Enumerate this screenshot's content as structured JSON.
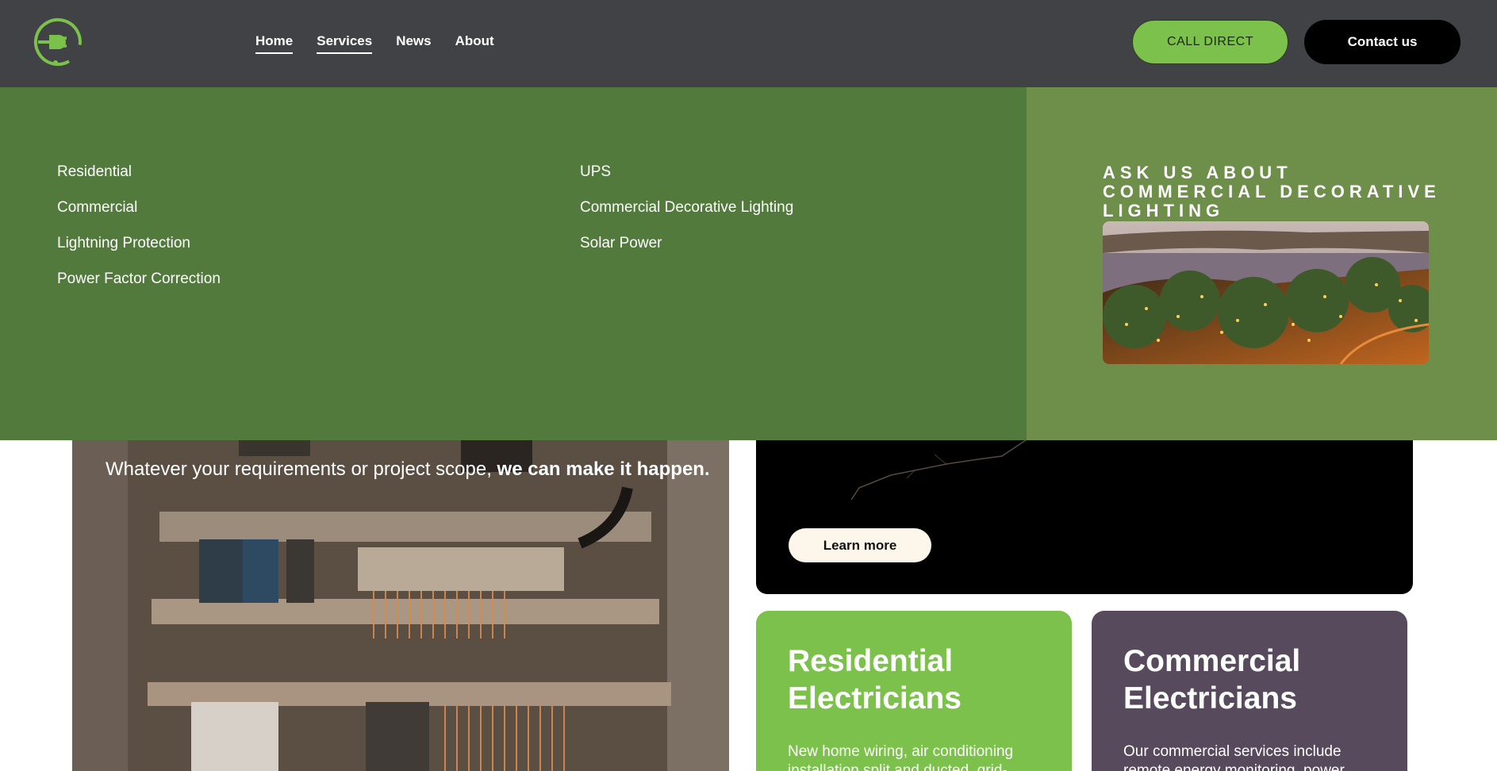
{
  "header": {
    "logo_icon": "plug-circle-icon",
    "nav": [
      {
        "label": "Home",
        "underlined": true
      },
      {
        "label": "Services",
        "underlined": true
      },
      {
        "label": "News",
        "underlined": false
      },
      {
        "label": "About",
        "underlined": false
      }
    ],
    "call_label": "CALL DIRECT",
    "contact_label": "Contact us"
  },
  "mega_menu": {
    "column1": [
      "Residential",
      "Commercial",
      "Lightning Protection",
      "Power Factor Correction"
    ],
    "column2": [
      "UPS",
      "Commercial Decorative Lighting",
      "Solar Power"
    ],
    "promo_title": "ASK US ABOUT COMMERCIAL DECORATIVE LIGHTING",
    "promo_image": "riverside-trees-with-fairy-lights-image"
  },
  "hero": {
    "text_regular": "Whatever your requirements or project scope, ",
    "text_bold": "we can make it happen.",
    "learn_more_label": "Learn more"
  },
  "cards": [
    {
      "title": "Residential Electricians",
      "desc": "New home wiring, air conditioning installation split and ducted, grid-"
    },
    {
      "title": "Commercial Electricians",
      "desc": "Our commercial services include remote energy monitoring, power"
    }
  ],
  "colors": {
    "header_bg": "#414246",
    "brand_green": "#7bc14b",
    "menu_green": "#527a3c",
    "promo_green": "#6d8f4a",
    "card_purple": "#564a5c"
  }
}
